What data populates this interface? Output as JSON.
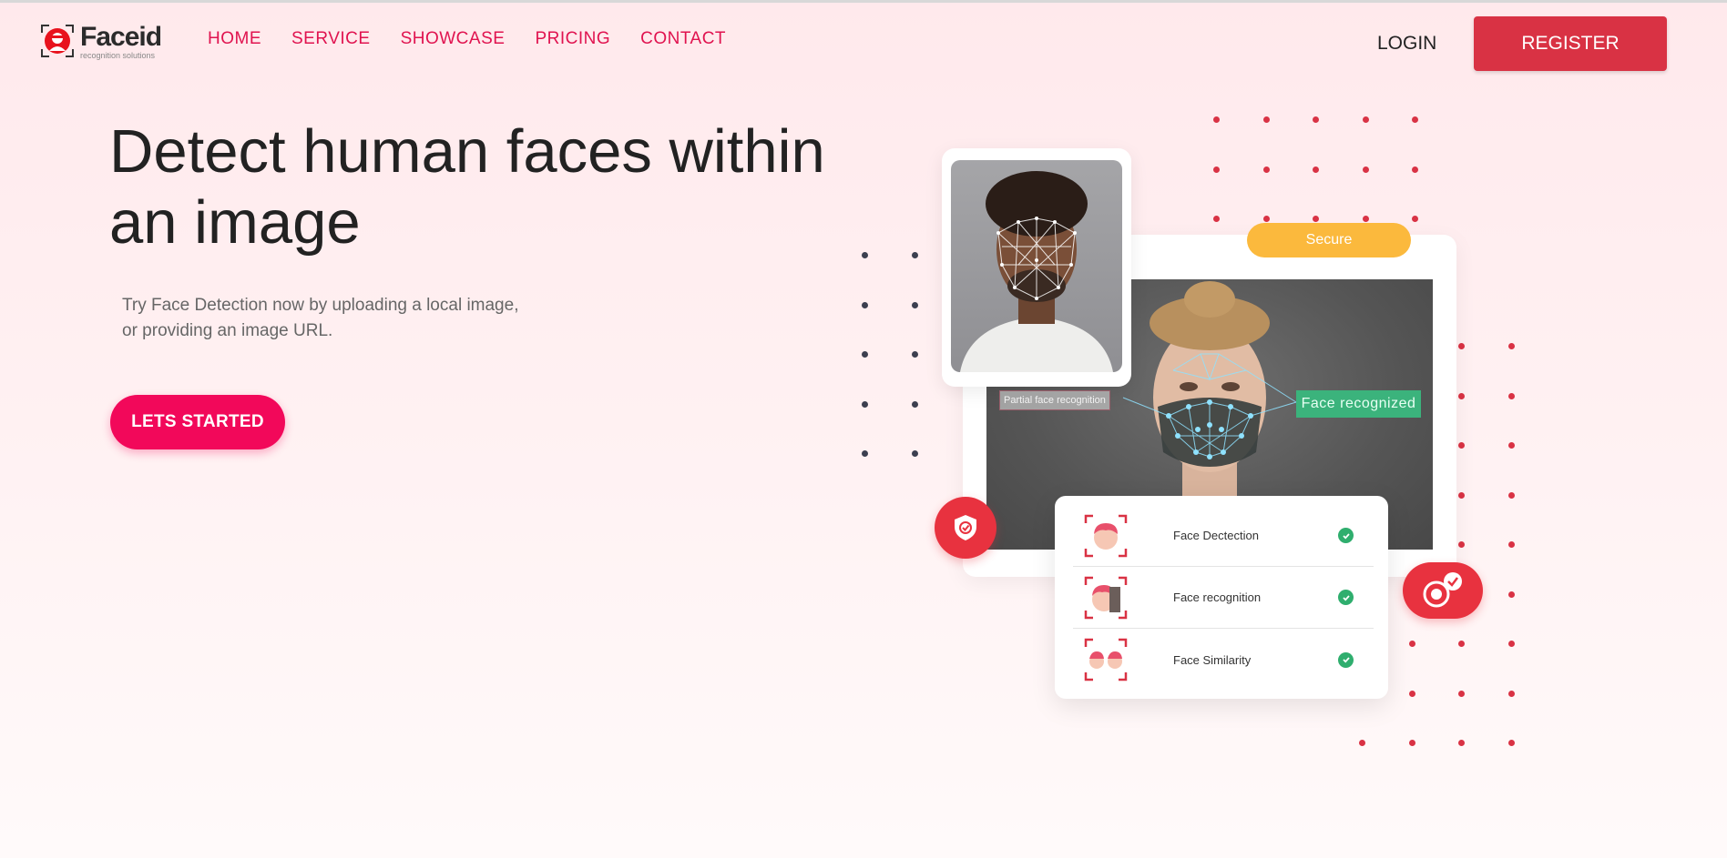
{
  "brand": {
    "name": "Faceid",
    "tagline": "recognition solutions",
    "accent_color": "#e0134f",
    "register_color": "#d93244"
  },
  "nav": {
    "items": [
      {
        "label": "HOME"
      },
      {
        "label": "SERVICE"
      },
      {
        "label": "SHOWCASE"
      },
      {
        "label": "PRICING"
      },
      {
        "label": "CONTACT"
      }
    ],
    "login_label": "LOGIN",
    "register_label": "REGISTER"
  },
  "hero": {
    "headline_line1": "Detect human faces within",
    "headline_line2": "an image",
    "subtitle_line1": "Try Face Detection now by uploading a local image,",
    "subtitle_line2": "or providing an image URL.",
    "cta_label": "LETS STARTED",
    "cta_color": "#f2085a"
  },
  "illustration": {
    "secure_label": "Secure",
    "secure_color": "#fbb93d",
    "partial_tag": "Partial face recognition",
    "recognized_tag": "Face recognized",
    "recognized_color": "#3bb37c",
    "shield_badge_icon": "shield-check-icon",
    "face_badge_icon": "face-check-icon",
    "features": [
      {
        "label": "Face Dectection",
        "icon": "face-detection-icon",
        "status": "check-icon"
      },
      {
        "label": "Face recognition",
        "icon": "face-recognition-icon",
        "status": "check-icon"
      },
      {
        "label": "Face Similarity",
        "icon": "face-similarity-icon",
        "status": "check-icon"
      }
    ]
  }
}
